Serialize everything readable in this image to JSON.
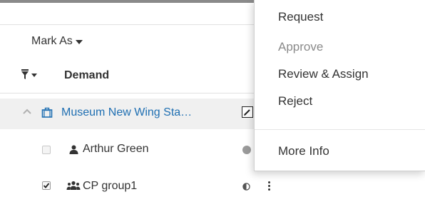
{
  "toolbar": {
    "mark_as_label": "Mark As"
  },
  "table": {
    "header": {
      "demand_label": "Demand"
    },
    "rows": [
      {
        "type": "group",
        "label": "Museum New Wing Sta…",
        "icon": "briefcase-icon"
      },
      {
        "type": "user",
        "label": "Arthur Green",
        "icon": "user-icon",
        "checked": false,
        "status_icon": "filled-circle-icon"
      },
      {
        "type": "group-member",
        "label": "CP group1",
        "icon": "users-icon",
        "checked": true,
        "status_icon": "half-circle-icon"
      }
    ]
  },
  "menu": {
    "items": [
      {
        "label": "Request",
        "enabled": true
      },
      {
        "label": "Approve",
        "enabled": false
      },
      {
        "label": "Review & Assign",
        "enabled": true
      },
      {
        "label": "Reject",
        "enabled": true
      },
      {
        "label": "More Info",
        "enabled": true
      }
    ]
  },
  "colors": {
    "link": "#1f6fb2",
    "text": "#333333",
    "disabled": "#8a8a8a",
    "group_row_bg": "#f0f0f0"
  }
}
